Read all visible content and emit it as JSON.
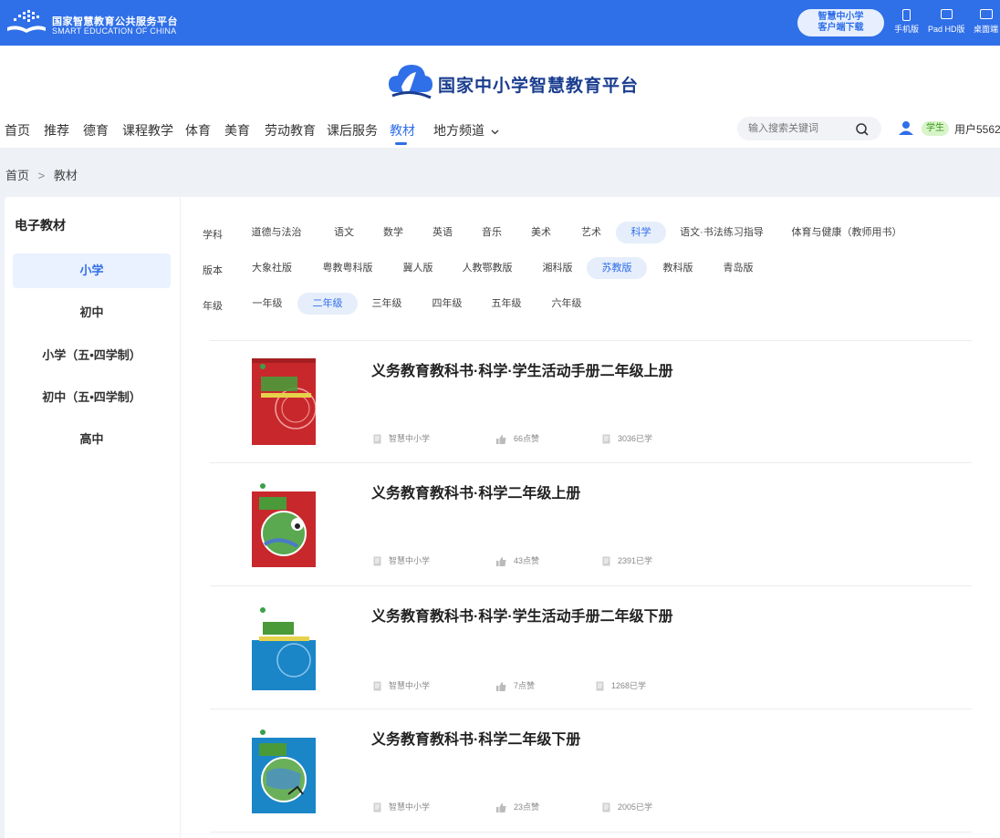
{
  "topbar": {
    "logo_cn": "国家智慧教育公共服务平台",
    "logo_en": "SMART EDUCATION OF CHINA",
    "download_line1": "智慧中小学",
    "download_line2": "客户端下载",
    "devices": [
      "手机版",
      "Pad HD版",
      "桌面端"
    ]
  },
  "header": {
    "brand_title": "国家中小学智慧教育平台",
    "nav": [
      {
        "label": "首页"
      },
      {
        "label": "推荐"
      },
      {
        "label": "德育"
      },
      {
        "label": "课程教学"
      },
      {
        "label": "体育"
      },
      {
        "label": "美育"
      },
      {
        "label": "劳动教育"
      },
      {
        "label": "课后服务"
      },
      {
        "label": "教材",
        "active": true
      },
      {
        "label": "地方频道"
      }
    ],
    "search_placeholder": "输入搜索关键词",
    "role": "学生",
    "username": "用户5562"
  },
  "breadcrumb": {
    "home": "首页",
    "sep": ">",
    "current": "教材"
  },
  "sidebar": {
    "title": "电子教材",
    "items": [
      "小学",
      "初中",
      "小学（五•四学制）",
      "初中（五•四学制）",
      "高中"
    ],
    "active_index": 0
  },
  "filters": {
    "subject": {
      "label": "学科",
      "options": [
        "道德与法治",
        "语文",
        "数学",
        "英语",
        "音乐",
        "美术",
        "艺术",
        "科学",
        "语文·书法练习指导",
        "体育与健康（教师用书）"
      ],
      "active": "科学"
    },
    "edition": {
      "label": "版本",
      "options": [
        "大象社版",
        "粤教粤科版",
        "冀人版",
        "人教鄂教版",
        "湘科版",
        "苏教版",
        "教科版",
        "青岛版"
      ],
      "active": "苏教版"
    },
    "grade": {
      "label": "年级",
      "options": [
        "一年级",
        "二年级",
        "三年级",
        "四年级",
        "五年级",
        "六年级"
      ],
      "active": "二年级"
    }
  },
  "books": [
    {
      "title": "义务教育教科书·科学·学生活动手册二年级上册",
      "source": "智慧中小学",
      "likes": "66点赞",
      "learned": "3036已学",
      "cover_color": "#c8282c"
    },
    {
      "title": "义务教育教科书·科学二年级上册",
      "source": "智慧中小学",
      "likes": "43点赞",
      "learned": "2391已学",
      "cover_color": "#c8282c"
    },
    {
      "title": "义务教育教科书·科学·学生活动手册二年级下册",
      "source": "智慧中小学",
      "likes": "7点赞",
      "learned": "1268已学",
      "cover_color": "#1a86c8"
    },
    {
      "title": "义务教育教科书·科学二年级下册",
      "source": "智慧中小学",
      "likes": "23点赞",
      "learned": "2005已学",
      "cover_color": "#1a86c8"
    }
  ],
  "colors": {
    "accent": "#2f6fe8",
    "topbar": "#2f6fe8",
    "student_badge": "#3a9a1e"
  }
}
